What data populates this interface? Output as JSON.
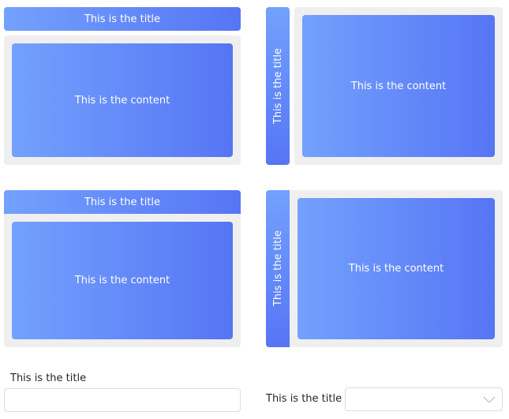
{
  "panels": {
    "top_left": {
      "title": "This is the title",
      "content": "This is the content"
    },
    "top_right": {
      "title": "This is the title",
      "content": "This is the content"
    },
    "bottom_left": {
      "title": "This is the title",
      "content": "This is the content"
    },
    "bottom_right": {
      "title": "This is the title",
      "content": "This is the content"
    }
  },
  "form": {
    "text_field": {
      "label": "This is the title",
      "value": ""
    },
    "select_field": {
      "label": "This is the title",
      "value": "",
      "icon": "chevron-down-icon"
    }
  },
  "colors": {
    "gradient_start": "#73a1fd",
    "gradient_end": "#5675f5",
    "panel_background": "#efefef",
    "field_border": "#dcdcdc"
  }
}
